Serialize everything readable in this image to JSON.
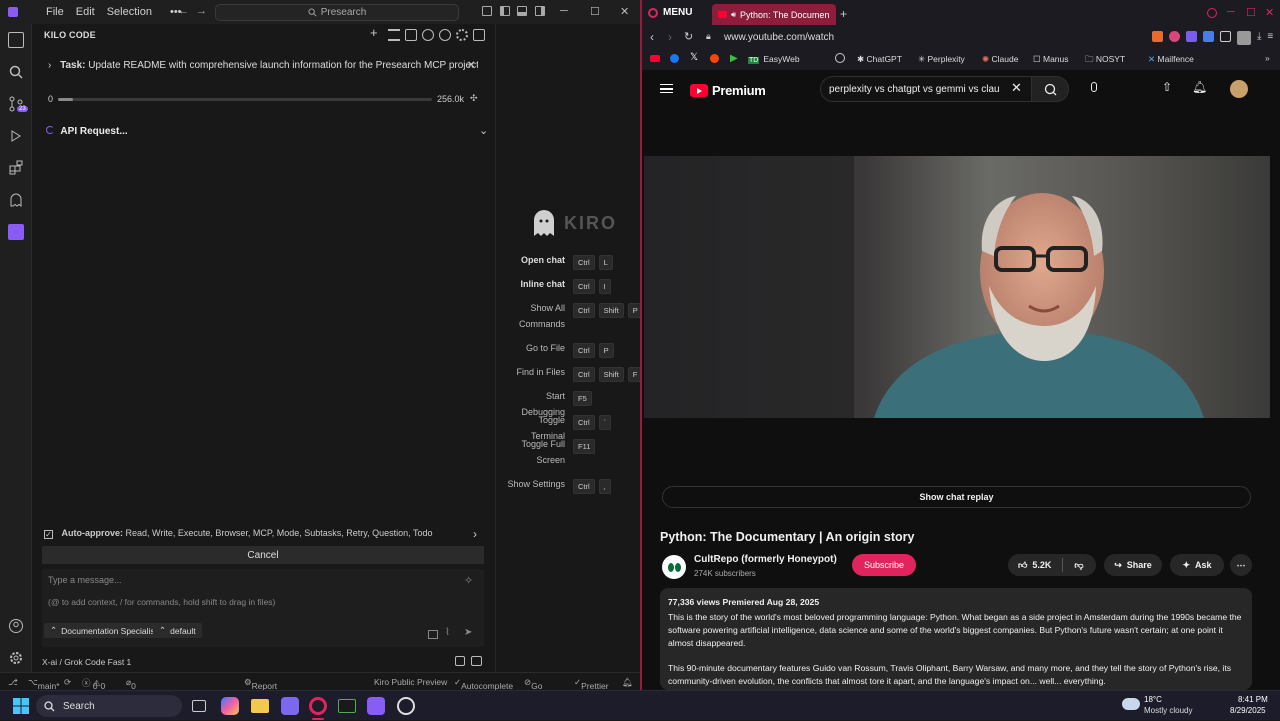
{
  "ide": {
    "menu": [
      "File",
      "Edit",
      "Selection",
      "•••"
    ],
    "command_center": "Presearch",
    "panel_title": "KILO CODE",
    "task_prefix": "Task:",
    "task_text": "Update README with comprehensive launch information for the Presearch MCP project. Context...",
    "context_start": "0",
    "context_max": "256.0k",
    "context_used_fraction": 0.0,
    "api_request": "API Request...",
    "auto_approve_label": "Auto-approve:",
    "auto_approve_list": "Read, Write, Execute, Browser, MCP, Mode, Subtasks, Retry, Question, Todo",
    "cancel_label": "Cancel",
    "message_placeholder": "Type a message...",
    "message_hint": "(@ to add context, / for commands, hold shift to drag in files)",
    "mode_chip": "Documentation Specialist",
    "profile_chip": "default",
    "model_label": "X-ai / Grok Code Fast 1"
  },
  "kiro": {
    "brand": "KIRO",
    "shortcuts": [
      {
        "label": "Open chat",
        "keys": [
          "Ctrl",
          "L"
        ],
        "bold": true
      },
      {
        "label": "Inline chat",
        "keys": [
          "Ctrl",
          "I"
        ],
        "bold": true
      },
      {
        "label": "Show All Commands",
        "keys": [
          "Ctrl",
          "Shift",
          "P"
        ],
        "bold": false
      },
      {
        "label": "Go to File",
        "keys": [
          "Ctrl",
          "P"
        ],
        "bold": false
      },
      {
        "label": "Find in Files",
        "keys": [
          "Ctrl",
          "Shift",
          "F"
        ],
        "bold": false
      },
      {
        "label": "Start Debugging",
        "keys": [
          "F5"
        ],
        "bold": false
      },
      {
        "label": "Toggle Terminal",
        "keys": [
          "Ctrl",
          "`"
        ],
        "bold": false
      },
      {
        "label": "Toggle Full Screen",
        "keys": [
          "F11"
        ],
        "bold": false
      },
      {
        "label": "Show Settings",
        "keys": [
          "Ctrl",
          ","
        ],
        "bold": false
      }
    ]
  },
  "statusbar": {
    "branch": "main*",
    "errors": "0",
    "warnings": "0",
    "ports": "0",
    "report": "Report a bug / Suggest an idea",
    "preview": "Kiro Public Preview",
    "autocomplete": "Autocomplete",
    "golive": "Go Live",
    "prettier": "Prettier"
  },
  "browser": {
    "menu_label": "MENU",
    "tab_title": "Python: The Documen",
    "url": "www.youtube.com/watch",
    "bookmarks": [
      "EasyWeb",
      "ChatGPT",
      "Perplexity",
      "Claude",
      "Manus",
      "NOSYT",
      "Mailfence"
    ],
    "yt_logo": "Premium",
    "search_query": "perplexity vs chatgpt vs gemmi vs clau",
    "chat_replay": "Show chat replay",
    "video_title": "Python: The Documentary | An origin story",
    "channel": "CultRepo (formerly Honeypot)",
    "subscribers": "274K subscribers",
    "subscribe": "Subscribe",
    "likes": "5.2K",
    "share": "Share",
    "ask": "Ask",
    "desc_meta": "77,336 views  Premiered Aug 28, 2025",
    "desc_p1": "This is the story of the world's most beloved programming language: Python. What began as a side project in Amsterdam during the 1990s became the software powering artificial intelligence, data science and some of the world's biggest companies. But Python's future wasn't certain; at one point it almost disappeared.",
    "desc_p2": "This 90-minute documentary features Guido van Rossum, Travis Oliphant, Barry Warsaw, and many more, and they tell the story of Python's rise, its community-driven evolution, the conflicts that almost tore it apart, and the language's impact on... well... everything."
  },
  "taskbar": {
    "search": "Search",
    "weather_temp": "18°C",
    "weather_desc": "Mostly cloudy",
    "time": "8:41 PM",
    "date": "8/29/2025"
  },
  "colors": {
    "accent_red": "#ff0033",
    "kilo_purple": "#8a5cf6",
    "browser_accent": "#e0245e"
  }
}
